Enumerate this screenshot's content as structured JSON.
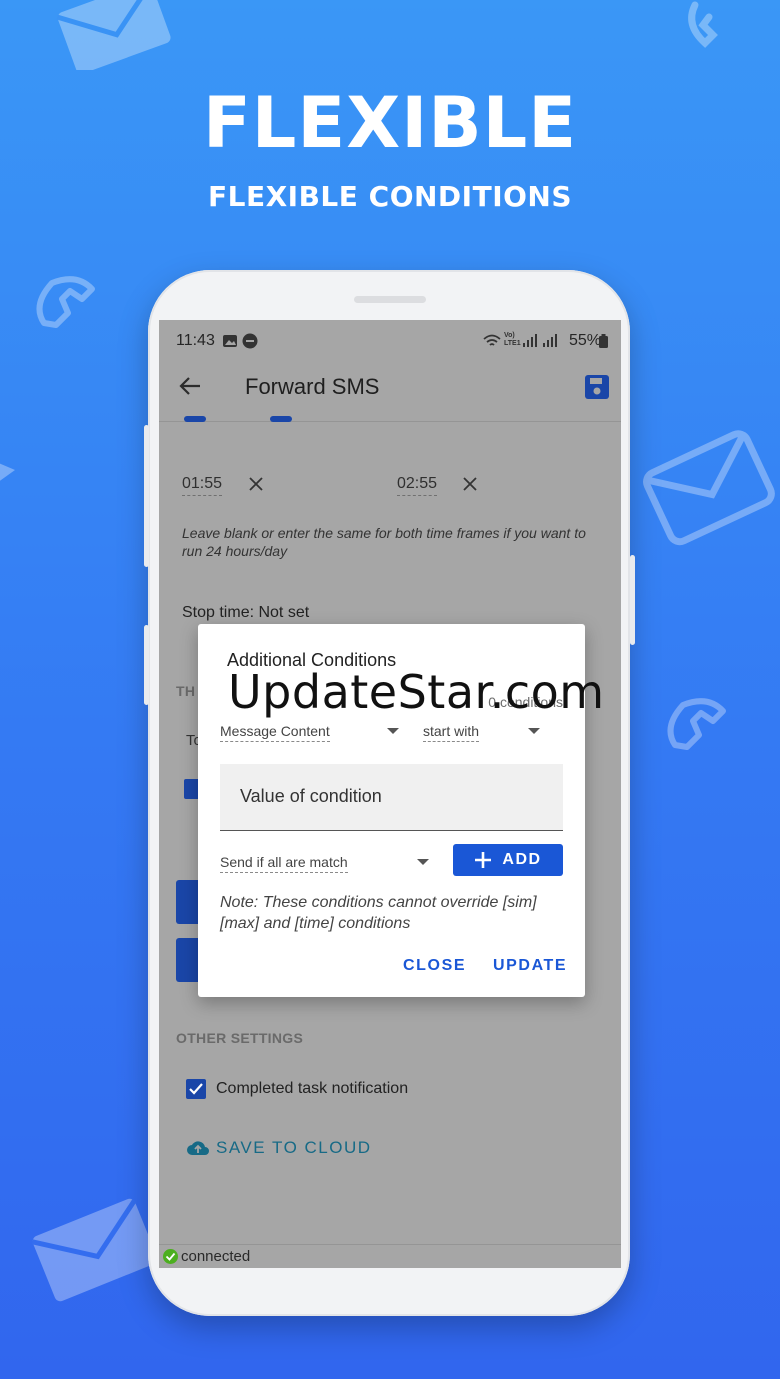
{
  "hero": {
    "title": "FLEXIBLE",
    "subtitle": "FLEXIBLE CONDITIONS"
  },
  "status_bar": {
    "time": "11:43",
    "signal_text": "Vo) LTE1",
    "battery": "55%"
  },
  "app_bar": {
    "title": "Forward SMS",
    "back_icon": "back-arrow-icon",
    "save_icon": "floppy-save-icon"
  },
  "time_range": {
    "start": "01:55",
    "end": "02:55",
    "hint": "Leave blank or enter the same for both time frames if you want to run 24 hours/day"
  },
  "stop_time": "Stop time: Not set",
  "obscured": {
    "section_label_fragment": "TH",
    "field_fragment": "To"
  },
  "other_settings": {
    "label": "OTHER SETTINGS",
    "completed_task": "Completed task notification",
    "save_to_cloud": "SAVE TO CLOUD"
  },
  "footer": {
    "connected": "connected"
  },
  "dialog": {
    "title": "Additional Conditions",
    "count": "0 conditions",
    "field_dropdown": "Message Content",
    "operator_dropdown": "start with",
    "value_placeholder": "Value of condition",
    "match_dropdown": "Send if all are match",
    "add_label": "ADD",
    "note": "Note: These conditions cannot override [sim][max] and [time] conditions",
    "close_label": "CLOSE",
    "update_label": "UPDATE"
  },
  "watermark": "UpdateStar.com",
  "colors": {
    "background_top": "#3a97f6",
    "background_bottom": "#3166ee",
    "accent_blue": "#1a57d6",
    "checkbox_blue": "#1a46a8",
    "cloud_teal": "#176a86",
    "connected_green": "#4caf1f"
  }
}
